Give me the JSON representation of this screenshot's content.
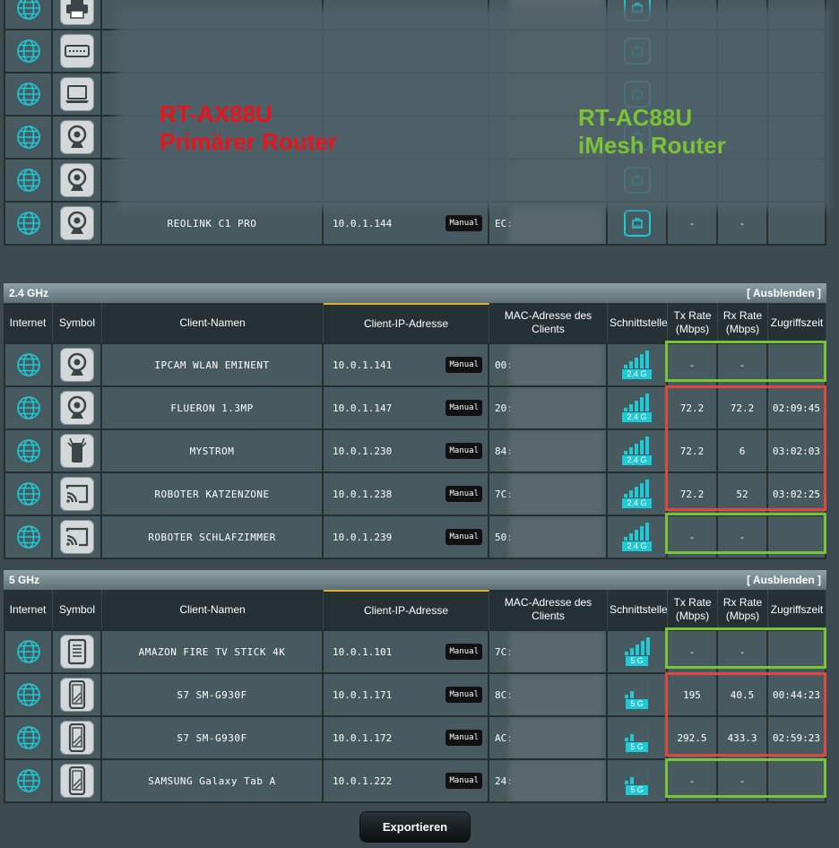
{
  "overlays": {
    "primary_line1": "RT-AX88U",
    "primary_line2": "Primärer Router",
    "mesh_line1": "RT-AC88U",
    "mesh_line2": "iMesh Router"
  },
  "wired_rows": [
    {
      "icon": "printer-icon",
      "name": "",
      "ip": "",
      "mac": ""
    },
    {
      "icon": "network-switch-icon",
      "name": "",
      "ip": "",
      "mac": ""
    },
    {
      "icon": "laptop-icon",
      "name": "",
      "ip": "",
      "mac": ""
    },
    {
      "icon": "webcam-icon",
      "name": "",
      "ip": "",
      "mac": ""
    },
    {
      "icon": "webcam-icon",
      "name": "",
      "ip": "",
      "mac": ""
    },
    {
      "icon": "webcam-icon",
      "name": "REOLINK C1 PRO",
      "ip": "10.0.1.144",
      "manual": "Manual",
      "mac": "EC:",
      "tx": "-",
      "rx": "-",
      "time": ""
    }
  ],
  "columns": {
    "internet": "Internet",
    "symbol": "Symbol",
    "client_name": "Client-Namen",
    "client_ip": "Client-IP-Adresse",
    "mac": "MAC-Adresse des Clients",
    "interface": "Schnittstelle",
    "tx": "Tx Rate (Mbps)",
    "rx": "Rx Rate (Mbps)",
    "access": "Zugriffszeit"
  },
  "sections": [
    {
      "title": "2.4 GHz",
      "hide_label": "[ Ausblenden ]",
      "rows": [
        {
          "icon": "webcam-icon",
          "name": "IPCAM WLAN EMINENT",
          "ip": "10.0.1.141",
          "manual": "Manual",
          "mac": "00:",
          "band": "2.4 G",
          "signal": 5,
          "tx": "-",
          "rx": "-",
          "time": ""
        },
        {
          "icon": "webcam-icon",
          "name": "FLUERON 1.3MP",
          "ip": "10.0.1.147",
          "manual": "Manual",
          "mac": "20:",
          "band": "2.4 G",
          "signal": 5,
          "tx": "72.2",
          "rx": "72.2",
          "time": "02:09:45"
        },
        {
          "icon": "smart-plug-icon",
          "name": "MYSTROM",
          "ip": "10.0.1.230",
          "manual": "Manual",
          "mac": "84:",
          "band": "2.4 G",
          "signal": 5,
          "tx": "72.2",
          "rx": "6",
          "time": "03:02:03"
        },
        {
          "icon": "cast-icon",
          "name": "ROBOTER KATZENZONE",
          "ip": "10.0.1.238",
          "manual": "Manual",
          "mac": "7C:",
          "band": "2.4 G",
          "signal": 5,
          "tx": "72.2",
          "rx": "52",
          "time": "03:02:25"
        },
        {
          "icon": "cast-icon",
          "name": "ROBOTER SCHLAFZIMMER",
          "ip": "10.0.1.239",
          "manual": "Manual",
          "mac": "50:",
          "band": "2.4 G",
          "signal": 5,
          "tx": "-",
          "rx": "-",
          "time": ""
        }
      ]
    },
    {
      "title": "5 GHz",
      "hide_label": "[ Ausblenden ]",
      "rows": [
        {
          "icon": "tablet-icon",
          "name": "AMAZON FIRE TV STICK 4K",
          "ip": "10.0.1.101",
          "manual": "Manual",
          "mac": "7C:",
          "band": "5 G",
          "signal": 5,
          "tx": "-",
          "rx": "-",
          "time": ""
        },
        {
          "icon": "smartphone-icon",
          "name": "S7 SM-G930F",
          "ip": "10.0.1.171",
          "manual": "Manual",
          "mac": "8C:",
          "band": "5 G",
          "signal": 2,
          "tx": "195",
          "rx": "40.5",
          "time": "00:44:23"
        },
        {
          "icon": "smartphone-icon",
          "name": "S7 SM-G930F",
          "ip": "10.0.1.172",
          "manual": "Manual",
          "mac": "AC:",
          "band": "5 G",
          "signal": 2,
          "tx": "292.5",
          "rx": "433.3",
          "time": "02:59:23"
        },
        {
          "icon": "smartphone-icon",
          "name": "SAMSUNG Galaxy Tab A",
          "ip": "10.0.1.222",
          "manual": "Manual",
          "mac": "24:",
          "band": "5 G",
          "signal": 2,
          "tx": "-",
          "rx": "-",
          "time": ""
        }
      ]
    }
  ],
  "export_label": "Exportieren",
  "colors": {
    "accent": "#1ec9d8",
    "highlight_green": "#7cc236",
    "highlight_red": "#e0483d",
    "overlay_red": "#e8131b"
  }
}
